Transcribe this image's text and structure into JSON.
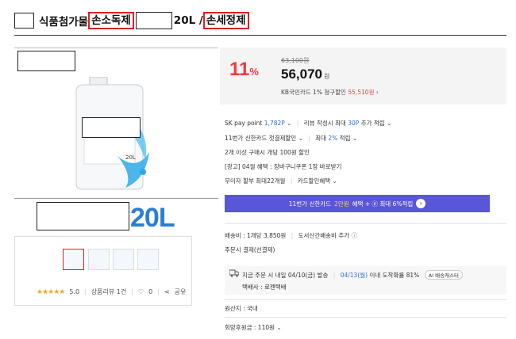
{
  "title": {
    "part1": "식품첨가물",
    "highlight1": "손소독제",
    "part2": "20L /",
    "highlight2": "손세정제"
  },
  "product_image": {
    "size_text": "20L",
    "jug_label": "20L"
  },
  "rating": {
    "stars": "★★★★★",
    "score": "5.0",
    "reviews": "상품리뷰 1건",
    "likes": "0",
    "share": "공유"
  },
  "price": {
    "discount": "11",
    "discount_unit": "%",
    "original": "63,100원",
    "sale": "56,070",
    "sale_unit": "원",
    "card_discount_prefix": "KB국민카드 1% 청구할인",
    "card_discount_price": "55,510원",
    "card_discount_arrow": "›"
  },
  "benefits": {
    "skpay_label": "SK pay point",
    "skpay_value": "1,782P",
    "review_text": "리뷰 작성시 최대",
    "review_value": "30P",
    "review_suffix": "추가 적립",
    "shinhan_first": "11번가 신한카드 첫결제할인",
    "max_label": "최대",
    "max_value": "2%",
    "max_suffix": "적립",
    "bulk": "2개 이상 구매시 개당 100원 할인",
    "ad": "[광고] 04월 혜택 : 장바구니쿠폰 1장 바로받기",
    "installment": "무이자 할부 최대22개월",
    "card_benefit": "카드할인혜택"
  },
  "banner": {
    "prefix": "11번가 신한카드",
    "amount": "2만원",
    "suffix": "혜택 + ⓟ 최대 6%적립",
    "arrow": "›"
  },
  "shipping": {
    "fee": "배송비 : 1개당 3,850원",
    "remote": "도서산간배송비 추가",
    "payment": "주문시 결제(선결제)",
    "order_text": "지금 주문 시 내일 04/10(금) 발송",
    "arrival": "04/13(월)",
    "arrival_suffix": "이내 도착확률 81%",
    "ai_badge": "AI 배송캐스터",
    "carrier": "택배사 : 로젠택배"
  },
  "origin": "원산지 : 국내",
  "coupon": "회망후원금 : 110원"
}
